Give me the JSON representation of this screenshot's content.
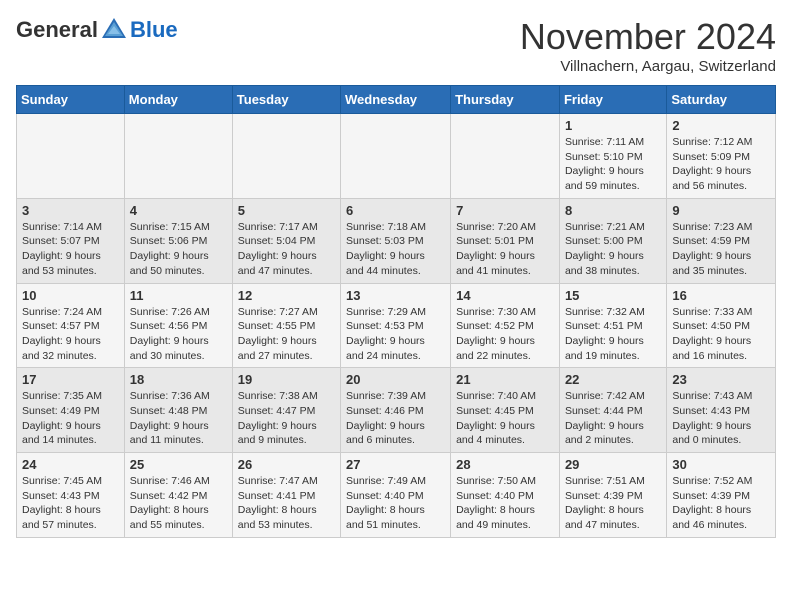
{
  "header": {
    "logo_general": "General",
    "logo_blue": "Blue",
    "month_title": "November 2024",
    "location": "Villnachern, Aargau, Switzerland"
  },
  "weekdays": [
    "Sunday",
    "Monday",
    "Tuesday",
    "Wednesday",
    "Thursday",
    "Friday",
    "Saturday"
  ],
  "weeks": [
    [
      {
        "day": "",
        "info": ""
      },
      {
        "day": "",
        "info": ""
      },
      {
        "day": "",
        "info": ""
      },
      {
        "day": "",
        "info": ""
      },
      {
        "day": "",
        "info": ""
      },
      {
        "day": "1",
        "info": "Sunrise: 7:11 AM\nSunset: 5:10 PM\nDaylight: 9 hours and 59 minutes."
      },
      {
        "day": "2",
        "info": "Sunrise: 7:12 AM\nSunset: 5:09 PM\nDaylight: 9 hours and 56 minutes."
      }
    ],
    [
      {
        "day": "3",
        "info": "Sunrise: 7:14 AM\nSunset: 5:07 PM\nDaylight: 9 hours and 53 minutes."
      },
      {
        "day": "4",
        "info": "Sunrise: 7:15 AM\nSunset: 5:06 PM\nDaylight: 9 hours and 50 minutes."
      },
      {
        "day": "5",
        "info": "Sunrise: 7:17 AM\nSunset: 5:04 PM\nDaylight: 9 hours and 47 minutes."
      },
      {
        "day": "6",
        "info": "Sunrise: 7:18 AM\nSunset: 5:03 PM\nDaylight: 9 hours and 44 minutes."
      },
      {
        "day": "7",
        "info": "Sunrise: 7:20 AM\nSunset: 5:01 PM\nDaylight: 9 hours and 41 minutes."
      },
      {
        "day": "8",
        "info": "Sunrise: 7:21 AM\nSunset: 5:00 PM\nDaylight: 9 hours and 38 minutes."
      },
      {
        "day": "9",
        "info": "Sunrise: 7:23 AM\nSunset: 4:59 PM\nDaylight: 9 hours and 35 minutes."
      }
    ],
    [
      {
        "day": "10",
        "info": "Sunrise: 7:24 AM\nSunset: 4:57 PM\nDaylight: 9 hours and 32 minutes."
      },
      {
        "day": "11",
        "info": "Sunrise: 7:26 AM\nSunset: 4:56 PM\nDaylight: 9 hours and 30 minutes."
      },
      {
        "day": "12",
        "info": "Sunrise: 7:27 AM\nSunset: 4:55 PM\nDaylight: 9 hours and 27 minutes."
      },
      {
        "day": "13",
        "info": "Sunrise: 7:29 AM\nSunset: 4:53 PM\nDaylight: 9 hours and 24 minutes."
      },
      {
        "day": "14",
        "info": "Sunrise: 7:30 AM\nSunset: 4:52 PM\nDaylight: 9 hours and 22 minutes."
      },
      {
        "day": "15",
        "info": "Sunrise: 7:32 AM\nSunset: 4:51 PM\nDaylight: 9 hours and 19 minutes."
      },
      {
        "day": "16",
        "info": "Sunrise: 7:33 AM\nSunset: 4:50 PM\nDaylight: 9 hours and 16 minutes."
      }
    ],
    [
      {
        "day": "17",
        "info": "Sunrise: 7:35 AM\nSunset: 4:49 PM\nDaylight: 9 hours and 14 minutes."
      },
      {
        "day": "18",
        "info": "Sunrise: 7:36 AM\nSunset: 4:48 PM\nDaylight: 9 hours and 11 minutes."
      },
      {
        "day": "19",
        "info": "Sunrise: 7:38 AM\nSunset: 4:47 PM\nDaylight: 9 hours and 9 minutes."
      },
      {
        "day": "20",
        "info": "Sunrise: 7:39 AM\nSunset: 4:46 PM\nDaylight: 9 hours and 6 minutes."
      },
      {
        "day": "21",
        "info": "Sunrise: 7:40 AM\nSunset: 4:45 PM\nDaylight: 9 hours and 4 minutes."
      },
      {
        "day": "22",
        "info": "Sunrise: 7:42 AM\nSunset: 4:44 PM\nDaylight: 9 hours and 2 minutes."
      },
      {
        "day": "23",
        "info": "Sunrise: 7:43 AM\nSunset: 4:43 PM\nDaylight: 9 hours and 0 minutes."
      }
    ],
    [
      {
        "day": "24",
        "info": "Sunrise: 7:45 AM\nSunset: 4:43 PM\nDaylight: 8 hours and 57 minutes."
      },
      {
        "day": "25",
        "info": "Sunrise: 7:46 AM\nSunset: 4:42 PM\nDaylight: 8 hours and 55 minutes."
      },
      {
        "day": "26",
        "info": "Sunrise: 7:47 AM\nSunset: 4:41 PM\nDaylight: 8 hours and 53 minutes."
      },
      {
        "day": "27",
        "info": "Sunrise: 7:49 AM\nSunset: 4:40 PM\nDaylight: 8 hours and 51 minutes."
      },
      {
        "day": "28",
        "info": "Sunrise: 7:50 AM\nSunset: 4:40 PM\nDaylight: 8 hours and 49 minutes."
      },
      {
        "day": "29",
        "info": "Sunrise: 7:51 AM\nSunset: 4:39 PM\nDaylight: 8 hours and 47 minutes."
      },
      {
        "day": "30",
        "info": "Sunrise: 7:52 AM\nSunset: 4:39 PM\nDaylight: 8 hours and 46 minutes."
      }
    ]
  ]
}
